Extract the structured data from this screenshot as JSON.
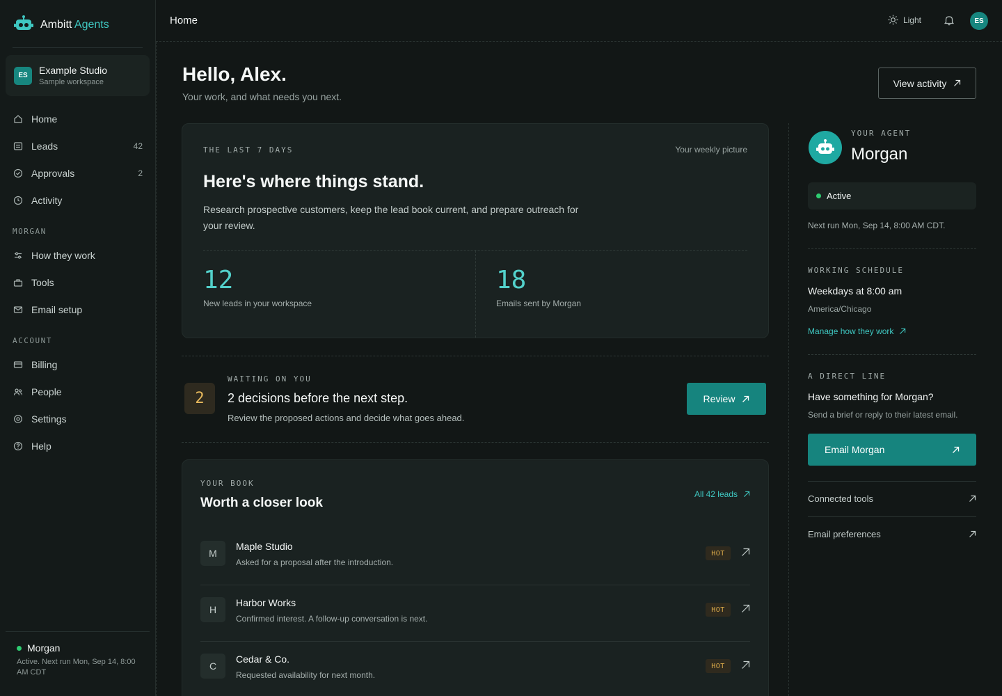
{
  "brand": {
    "name_primary": "Ambitt",
    "name_accent": "Agents"
  },
  "workspace": {
    "badge": "ES",
    "name": "Example Studio",
    "subtitle": "Sample workspace"
  },
  "nav": {
    "home": "Home",
    "leads": "Leads",
    "leads_count": "42",
    "approvals": "Approvals",
    "approvals_count": "2",
    "activity": "Activity",
    "section_morgan": "MORGAN",
    "how_they_work": "How they work",
    "tools": "Tools",
    "email_setup": "Email setup",
    "section_account": "ACCOUNT",
    "billing": "Billing",
    "people": "People",
    "settings": "Settings",
    "help": "Help"
  },
  "sidebar_footer": {
    "name": "Morgan",
    "status": "Active. Next run Mon, Sep 14, 8:00 AM CDT"
  },
  "topbar": {
    "title": "Home",
    "theme_label": "Light",
    "avatar": "ES"
  },
  "header": {
    "greeting": "Hello, Alex.",
    "subtitle": "Your work, and what needs you next.",
    "view_activity": "View activity"
  },
  "summary": {
    "eyebrow": "THE LAST 7 DAYS",
    "right_label": "Your weekly picture",
    "title": "Here's where things stand.",
    "description": "Research prospective customers, keep the lead book current, and prepare outreach for your review.",
    "stats": [
      {
        "value": "12",
        "label": "New leads in your workspace"
      },
      {
        "value": "18",
        "label": "Emails sent by Morgan"
      }
    ]
  },
  "waiting": {
    "count": "2",
    "eyebrow": "WAITING ON YOU",
    "title": "2 decisions before the next step.",
    "description": "Review the proposed actions and decide what goes ahead.",
    "button": "Review"
  },
  "book": {
    "eyebrow": "YOUR BOOK",
    "title": "Worth a closer look",
    "all_link": "All 42 leads",
    "leads": [
      {
        "initial": "M",
        "name": "Maple Studio",
        "desc": "Asked for a proposal after the introduction.",
        "tag": "HOT"
      },
      {
        "initial": "H",
        "name": "Harbor Works",
        "desc": "Confirmed interest. A follow-up conversation is next.",
        "tag": "HOT"
      },
      {
        "initial": "C",
        "name": "Cedar & Co.",
        "desc": "Requested availability for next month.",
        "tag": "HOT"
      }
    ]
  },
  "agent": {
    "eyebrow": "YOUR AGENT",
    "name": "Morgan",
    "status": "Active",
    "next_run": "Next run Mon, Sep 14, 8:00 AM CDT.",
    "schedule_eyebrow": "WORKING SCHEDULE",
    "schedule": "Weekdays at 8:00 am",
    "timezone": "America/Chicago",
    "manage_link": "Manage how they work",
    "direct_eyebrow": "A DIRECT LINE",
    "direct_title": "Have something for Morgan?",
    "direct_sub": "Send a brief or reply to their latest email.",
    "email_button": "Email Morgan",
    "connected_tools": "Connected tools",
    "email_prefs": "Email preferences"
  },
  "colors": {
    "accent": "#3fc7c1",
    "primary_button": "#16847e",
    "background": "#121716",
    "hot": "#d9a94a",
    "active": "#2ecc71"
  }
}
